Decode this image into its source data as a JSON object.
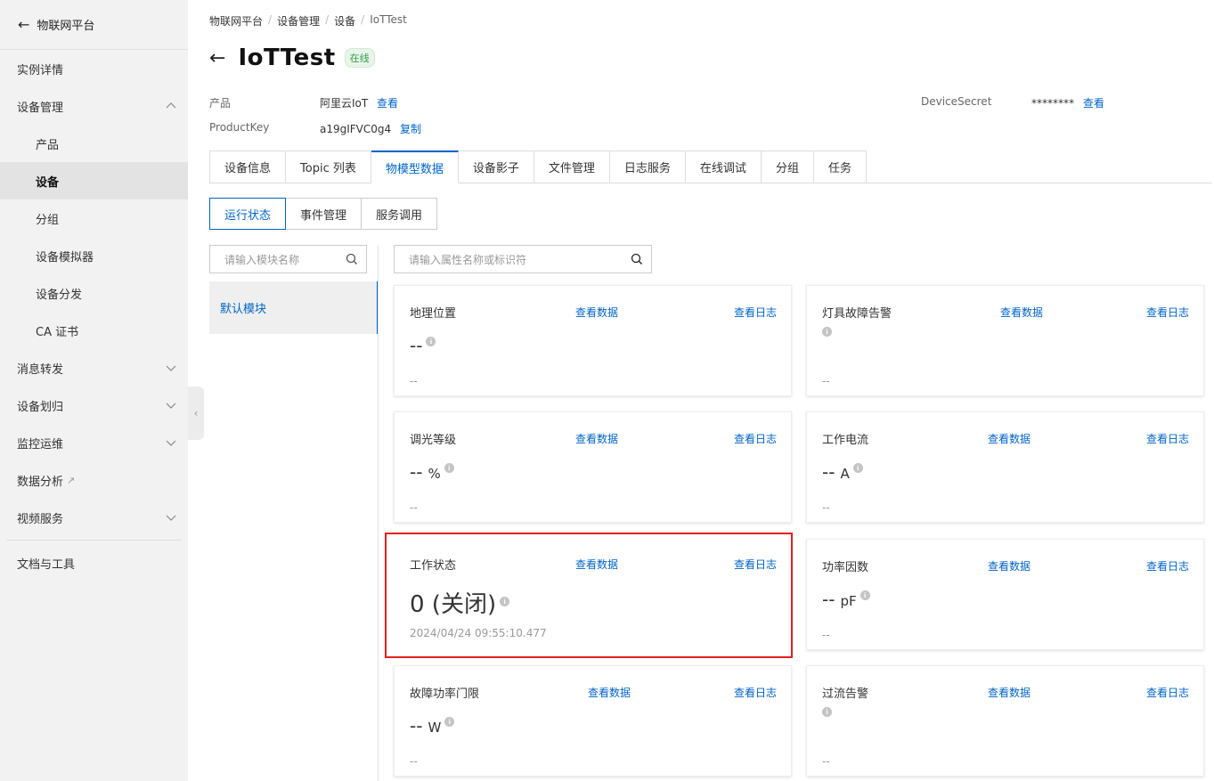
{
  "sidebar": {
    "header": "物联网平台",
    "items": [
      {
        "label": "实例详情"
      },
      {
        "label": "设备管理"
      },
      {
        "label": "产品"
      },
      {
        "label": "设备"
      },
      {
        "label": "分组"
      },
      {
        "label": "设备模拟器"
      },
      {
        "label": "设备分发"
      },
      {
        "label": "CA 证书"
      },
      {
        "label": "消息转发"
      },
      {
        "label": "设备划归"
      },
      {
        "label": "监控运维"
      },
      {
        "label": "数据分析"
      },
      {
        "label": "视频服务"
      },
      {
        "label": "文档与工具"
      }
    ]
  },
  "breadcrumb": [
    "物联网平台",
    "设备管理",
    "设备",
    "IoTTest"
  ],
  "device": {
    "name": "IoTTest",
    "status": "在线",
    "product_key_label": "产品",
    "product_value": "阿里云IoT",
    "view_link": "查看",
    "productkey_label": "ProductKey",
    "productkey_value": "a19gIFVC0g4",
    "copy_link": "复制",
    "secret_label": "DeviceSecret",
    "secret_value": "********",
    "secret_view": "查看"
  },
  "tabs": [
    "设备信息",
    "Topic 列表",
    "物模型数据",
    "设备影子",
    "文件管理",
    "日志服务",
    "在线调试",
    "分组",
    "任务"
  ],
  "subtabs": [
    "运行状态",
    "事件管理",
    "服务调用"
  ],
  "module_search": {
    "placeholder": "请输入模块名称"
  },
  "modules": [
    "默认模块"
  ],
  "prop_search": {
    "placeholder": "请输入属性名称或标识符"
  },
  "card_links": {
    "data": "查看数据",
    "log": "查看日志"
  },
  "cards": [
    {
      "name": "地理位置",
      "value": "--",
      "unit": "",
      "foot": "--"
    },
    {
      "name": "灯具故障告警",
      "value": "",
      "unit": "",
      "foot": "--"
    },
    {
      "name": "调光等级",
      "value": "--",
      "unit": "%",
      "foot": "--"
    },
    {
      "name": "工作电流",
      "value": "--",
      "unit": "A",
      "foot": "--"
    },
    {
      "name": "工作状态",
      "value": "0 (关闭)",
      "unit": "",
      "foot": "2024/04/24 09:55:10.477"
    },
    {
      "name": "功率因数",
      "value": "--",
      "unit": "pF",
      "foot": "--"
    },
    {
      "name": "故障功率门限",
      "value": "--",
      "unit": "W",
      "foot": "--"
    },
    {
      "name": "过流告警",
      "value": "",
      "unit": "",
      "foot": "--"
    }
  ],
  "colors": {
    "accent": "#0064c8",
    "highlight": "#e02020",
    "online": "#2e9e48"
  }
}
